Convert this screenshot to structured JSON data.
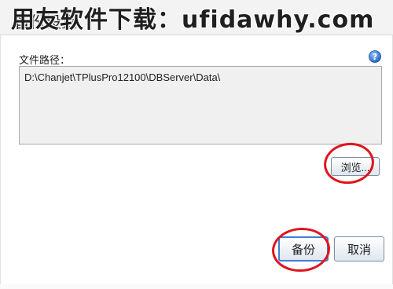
{
  "dialog": {
    "title": "备份设置",
    "watermark": "用友软件下载：ufidawhy.com"
  },
  "form": {
    "path_label": "文件路径：",
    "path_value": "D:\\Chanjet\\TPlusPro12100\\DBServer\\Data\\"
  },
  "buttons": {
    "browse": "浏览...",
    "backup": "备份",
    "cancel": "取消"
  },
  "icons": {
    "help": "help-icon"
  },
  "colors": {
    "annotation": "#e0141c",
    "accent": "#3c7fd6"
  }
}
